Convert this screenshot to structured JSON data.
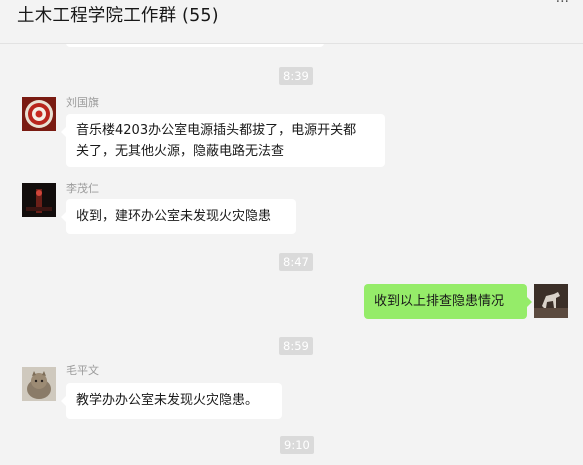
{
  "header": {
    "title": "土木工程学院工作群 (55)"
  },
  "colors": {
    "background": "#f3f3f3",
    "bubble_received": "#ffffff",
    "bubble_sent": "#95ec69",
    "timestamp_bg": "#dadada",
    "sender_name": "#9b9b9b"
  },
  "messages": {
    "time1": "8:39",
    "m1": {
      "sender": "刘国旗",
      "line1": "音乐楼4203办公室电源插头都拔了，电源开关都",
      "line2": "关了，无其他火源，隐蔽电路无法查"
    },
    "m2": {
      "sender": "李茂仁",
      "text": "收到，建环办公室未发现火灾隐患"
    },
    "time2": "8:47",
    "m3": {
      "text": "收到以上排查隐患情况"
    },
    "time3": "8:59",
    "m4": {
      "sender": "毛平文",
      "text": "教学办办公室未发现火灾隐患。"
    },
    "time4": "9:10"
  }
}
